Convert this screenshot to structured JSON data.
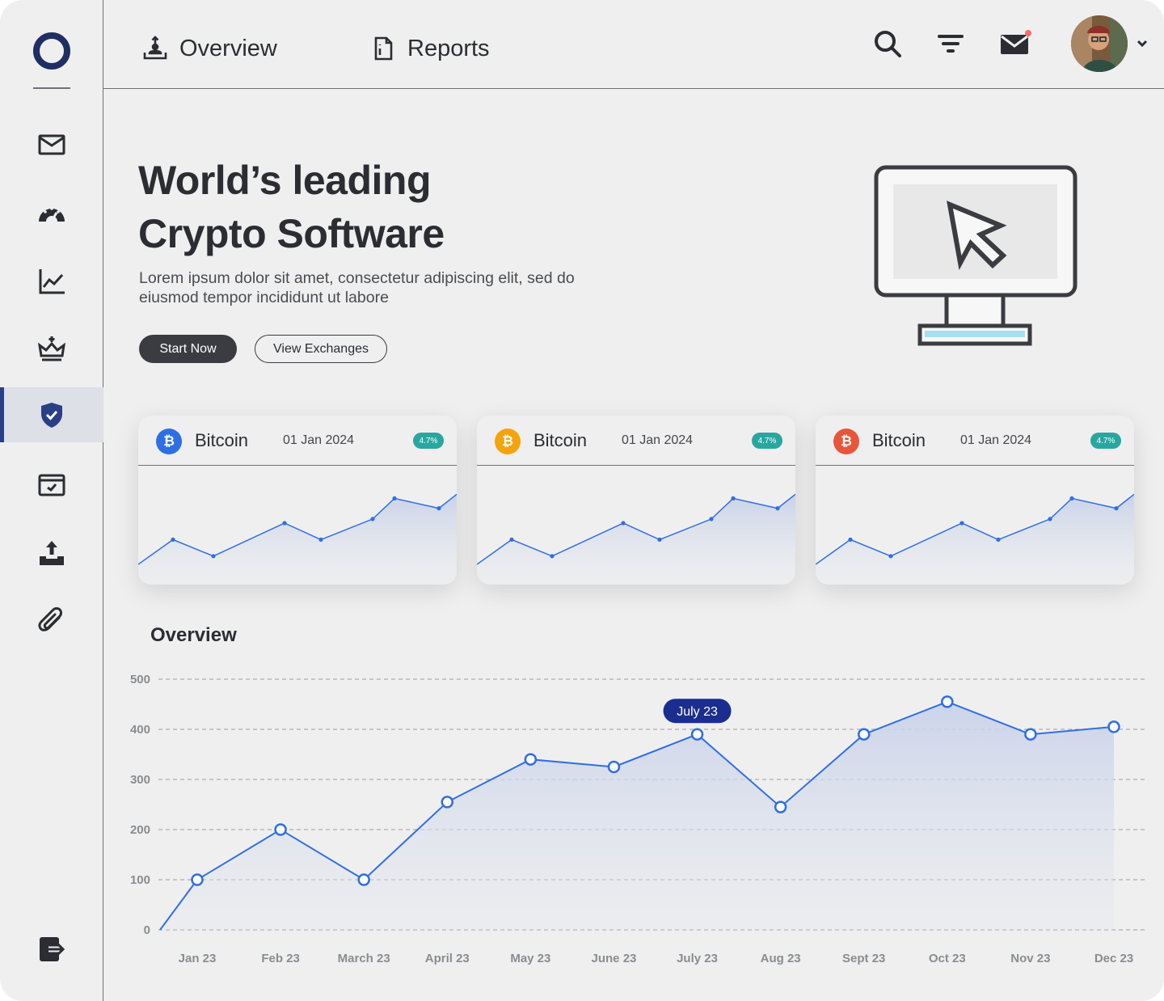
{
  "nav": {
    "overview_label": "Overview",
    "reports_label": "Reports"
  },
  "sidebar": {
    "items": [
      {
        "name": "mail-icon"
      },
      {
        "name": "dashboard-gauge-icon"
      },
      {
        "name": "line-chart-icon"
      },
      {
        "name": "crown-icon"
      },
      {
        "name": "shield-check-icon",
        "active": true
      },
      {
        "name": "browser-window-icon"
      },
      {
        "name": "upload-icon"
      },
      {
        "name": "paperclip-icon"
      }
    ],
    "logout_icon": "logout-icon"
  },
  "topbar": {
    "icons": [
      "search-icon",
      "filter-icon",
      "mail-notification-icon"
    ],
    "notification_dot_color": "#ff6b6b"
  },
  "hero": {
    "title_line1": "World’s leading",
    "title_line2": "Crypto Software",
    "subtitle": "Lorem ipsum dolor sit amet, consectetur adipiscing elit, sed do eiusmod tempor incididunt ut labore",
    "start_button": "Start Now",
    "view_button": "View Exchanges",
    "illustration": "monitor-cursor-icon"
  },
  "cards": [
    {
      "name": "Bitcoin",
      "date": "01 Jan 2024",
      "badge": "4.7%",
      "icon_color": "#2f6fe4",
      "symbol": "₿"
    },
    {
      "name": "Bitcoin",
      "date": "01 Jan 2024",
      "badge": "4.7%",
      "icon_color": "#f5a30d",
      "symbol": "₿"
    },
    {
      "name": "Bitcoin",
      "date": "01 Jan 2024",
      "badge": "4.7%",
      "icon_color": "#e8553a",
      "symbol": "₿"
    }
  ],
  "overview": {
    "title": "Overview",
    "tooltip": "July 23"
  },
  "colors": {
    "accent": "#2f6fe4",
    "navy": "#1f2f63",
    "tooltip_bg": "#1b2d8f"
  },
  "chart_data": [
    {
      "type": "area",
      "title": "Overview",
      "categories": [
        "Jan 23",
        "Feb 23",
        "March 23",
        "April 23",
        "May 23",
        "June 23",
        "July 23",
        "Aug 23",
        "Sept 23",
        "Oct 23",
        "Nov 23",
        "Dec 23"
      ],
      "series": [
        {
          "values": [
            100,
            200,
            100,
            255,
            340,
            325,
            390,
            245,
            390,
            455,
            390,
            405
          ]
        }
      ],
      "yticks": [
        0,
        100,
        200,
        300,
        400,
        500
      ],
      "ylim": [
        0,
        500
      ],
      "highlight": "July 23",
      "grid": true
    },
    {
      "type": "area",
      "series": [
        {
          "values": [
            0,
            30,
            10,
            50,
            30,
            55,
            80,
            68,
            85
          ]
        }
      ],
      "ylim": [
        0,
        100
      ]
    }
  ]
}
